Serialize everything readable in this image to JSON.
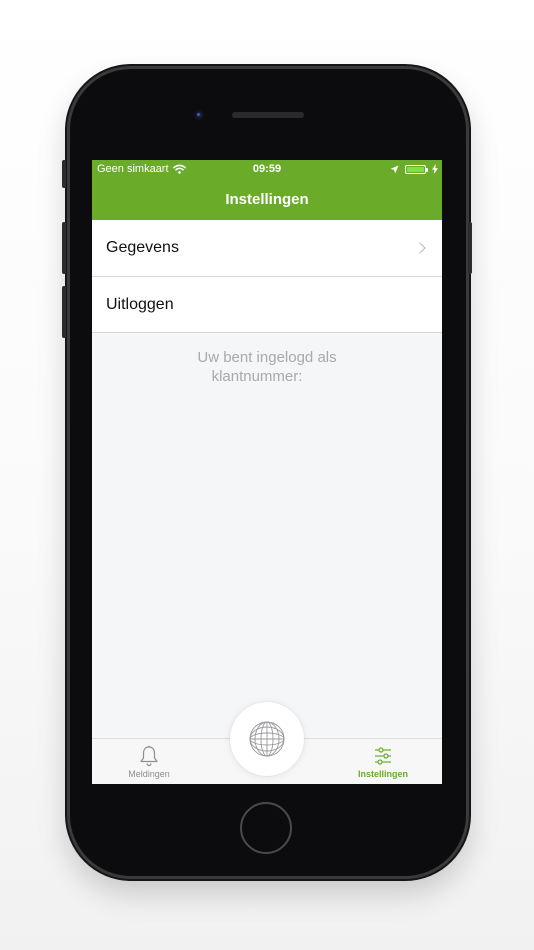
{
  "status_bar": {
    "carrier": "Geen simkaart",
    "time": "09:59",
    "icons": [
      "wifi-icon",
      "location-icon",
      "battery-icon",
      "charging-bolt-icon"
    ]
  },
  "nav": {
    "title": "Instellingen"
  },
  "menu": {
    "items": [
      {
        "label": "Gegevens",
        "icon": "chevron-right-icon"
      },
      {
        "label": "Uitloggen"
      }
    ]
  },
  "login_info": {
    "line1": "Uw bent ingelogd als",
    "line2": "klantnummer:"
  },
  "tabs": [
    {
      "label": "Meldingen",
      "icon": "bell-icon"
    },
    {
      "label": "Instellingen",
      "icon": "sliders-icon"
    }
  ],
  "center_button": {
    "icon": "globe-icon"
  },
  "colors": {
    "brand_green": "#6aab2a",
    "background": "#f5f6f8",
    "muted_text": "#a7a9ad",
    "tab_inactive": "#8e8e93"
  }
}
